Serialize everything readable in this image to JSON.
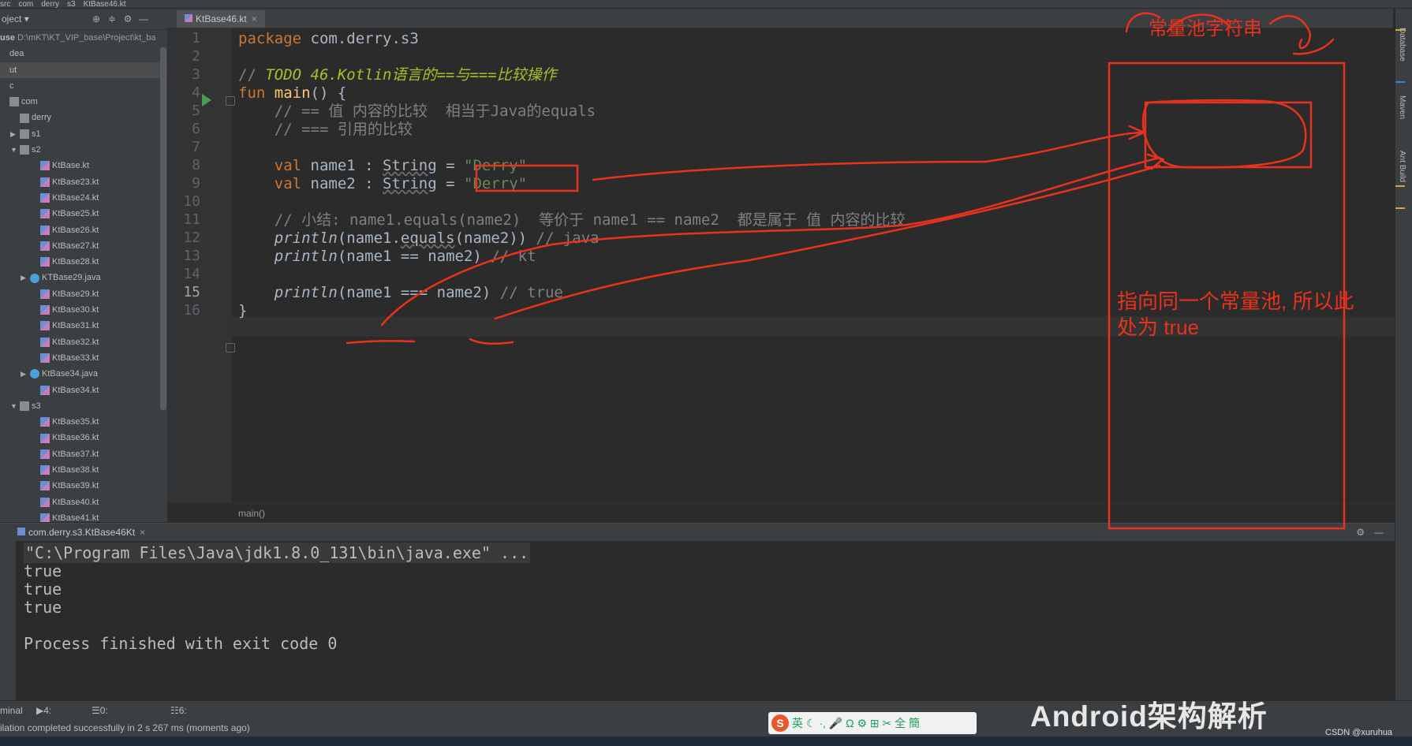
{
  "top_breadcrumb": [
    "src",
    "com",
    "derry",
    "s3",
    "KtBase46.kt"
  ],
  "project_panel": {
    "title": "oject",
    "root_label": "use",
    "root_path": "D:\\mKT\\KT_VIP_base\\Project\\kt_ba",
    "items": [
      {
        "label": "dea",
        "indent": 0,
        "arrow": "",
        "icon": "none"
      },
      {
        "label": "ut",
        "indent": 0,
        "arrow": "",
        "icon": "none",
        "selected": true
      },
      {
        "label": "c",
        "indent": 0,
        "arrow": "",
        "icon": "none"
      },
      {
        "label": "com",
        "indent": 0,
        "arrow": "",
        "icon": "folder"
      },
      {
        "label": "derry",
        "indent": 1,
        "arrow": "",
        "icon": "folder"
      },
      {
        "label": "s1",
        "indent": 1,
        "arrow": "▶",
        "icon": "folder"
      },
      {
        "label": "s2",
        "indent": 1,
        "arrow": "▼",
        "icon": "folder"
      },
      {
        "label": "KtBase.kt",
        "indent": 3,
        "arrow": "",
        "icon": "kt"
      },
      {
        "label": "KtBase23.kt",
        "indent": 3,
        "arrow": "",
        "icon": "kt"
      },
      {
        "label": "KtBase24.kt",
        "indent": 3,
        "arrow": "",
        "icon": "kt"
      },
      {
        "label": "KtBase25.kt",
        "indent": 3,
        "arrow": "",
        "icon": "kt"
      },
      {
        "label": "KtBase26.kt",
        "indent": 3,
        "arrow": "",
        "icon": "kt"
      },
      {
        "label": "KtBase27.kt",
        "indent": 3,
        "arrow": "",
        "icon": "kt"
      },
      {
        "label": "KtBase28.kt",
        "indent": 3,
        "arrow": "",
        "icon": "kt"
      },
      {
        "label": "KTBase29.java",
        "indent": 2,
        "arrow": "▶",
        "icon": "java"
      },
      {
        "label": "KtBase29.kt",
        "indent": 3,
        "arrow": "",
        "icon": "kt"
      },
      {
        "label": "KtBase30.kt",
        "indent": 3,
        "arrow": "",
        "icon": "kt"
      },
      {
        "label": "KtBase31.kt",
        "indent": 3,
        "arrow": "",
        "icon": "kt"
      },
      {
        "label": "KtBase32.kt",
        "indent": 3,
        "arrow": "",
        "icon": "kt"
      },
      {
        "label": "KtBase33.kt",
        "indent": 3,
        "arrow": "",
        "icon": "kt"
      },
      {
        "label": "KtBase34.java",
        "indent": 2,
        "arrow": "▶",
        "icon": "java"
      },
      {
        "label": "KtBase34.kt",
        "indent": 3,
        "arrow": "",
        "icon": "kt"
      },
      {
        "label": "s3",
        "indent": 1,
        "arrow": "▼",
        "icon": "folder"
      },
      {
        "label": "KtBase35.kt",
        "indent": 3,
        "arrow": "",
        "icon": "kt"
      },
      {
        "label": "KtBase36.kt",
        "indent": 3,
        "arrow": "",
        "icon": "kt"
      },
      {
        "label": "KtBase37.kt",
        "indent": 3,
        "arrow": "",
        "icon": "kt"
      },
      {
        "label": "KtBase38.kt",
        "indent": 3,
        "arrow": "",
        "icon": "kt"
      },
      {
        "label": "KtBase39.kt",
        "indent": 3,
        "arrow": "",
        "icon": "kt"
      },
      {
        "label": "KtBase40.kt",
        "indent": 3,
        "arrow": "",
        "icon": "kt"
      },
      {
        "label": "KtBase41.kt",
        "indent": 3,
        "arrow": "",
        "icon": "kt"
      }
    ]
  },
  "editor": {
    "tab_label": "KtBase46.kt",
    "current_line": 15,
    "line_numbers": [
      "1",
      "2",
      "3",
      "4",
      "5",
      "6",
      "7",
      "8",
      "9",
      "10",
      "11",
      "12",
      "13",
      "14",
      "15",
      "16"
    ],
    "breadcrumb": "main()",
    "code_lines": [
      [
        {
          "t": "package ",
          "c": "kw"
        },
        {
          "t": "com.derry.s3",
          "c": "pl"
        }
      ],
      [],
      [
        {
          "t": "// ",
          "c": "cmt"
        },
        {
          "t": "TODO 46.Kotlin语言的==与===比较操作",
          "c": "todo"
        }
      ],
      [
        {
          "t": "fun ",
          "c": "kw"
        },
        {
          "t": "main",
          "c": "fn"
        },
        {
          "t": "() {",
          "c": "pl"
        }
      ],
      [
        {
          "t": "    // == 值 内容的比较  相当于Java的equals",
          "c": "cmt"
        }
      ],
      [
        {
          "t": "    // === 引用的比较",
          "c": "cmt"
        }
      ],
      [],
      [
        {
          "t": "    ",
          "c": "pl"
        },
        {
          "t": "val ",
          "c": "kw"
        },
        {
          "t": "name1 : ",
          "c": "pl"
        },
        {
          "t": "String",
          "c": "pl ul"
        },
        {
          "t": " = ",
          "c": "pl"
        },
        {
          "t": "\"Derry\"",
          "c": "str"
        }
      ],
      [
        {
          "t": "    ",
          "c": "pl"
        },
        {
          "t": "val ",
          "c": "kw"
        },
        {
          "t": "name2 : ",
          "c": "pl"
        },
        {
          "t": "String",
          "c": "pl ul"
        },
        {
          "t": " = ",
          "c": "pl"
        },
        {
          "t": "\"Derry\"",
          "c": "str"
        }
      ],
      [],
      [
        {
          "t": "    // 小结: name1.equals(name2)  等价于 name1 == name2  都是属于 值 内容的比较",
          "c": "cmt"
        }
      ],
      [
        {
          "t": "    ",
          "c": "pl"
        },
        {
          "t": "println",
          "c": "pl it"
        },
        {
          "t": "(name1.",
          "c": "pl"
        },
        {
          "t": "equals",
          "c": "pl ul"
        },
        {
          "t": "(name2)) ",
          "c": "pl"
        },
        {
          "t": "// java",
          "c": "cmt"
        }
      ],
      [
        {
          "t": "    ",
          "c": "pl"
        },
        {
          "t": "println",
          "c": "pl it"
        },
        {
          "t": "(name1 == name2) ",
          "c": "pl"
        },
        {
          "t": "// kt",
          "c": "cmt"
        }
      ],
      [],
      [
        {
          "t": "    ",
          "c": "pl"
        },
        {
          "t": "println",
          "c": "pl it"
        },
        {
          "t": "(name1 === name2) ",
          "c": "pl"
        },
        {
          "t": "// true",
          "c": "cmt"
        }
      ],
      [
        {
          "t": "}",
          "c": "pl"
        }
      ]
    ]
  },
  "run_panel": {
    "tab_label": "com.derry.s3.KtBase46Kt",
    "output_lines": [
      "\"C:\\Program Files\\Java\\jdk1.8.0_131\\bin\\java.exe\" ...",
      "true",
      "true",
      "true",
      "",
      "Process finished with exit code 0"
    ]
  },
  "tool_tabs": [
    "minal",
    "4: Run",
    "0: Messages",
    "6: TODO"
  ],
  "status_text": "ilation completed successfully in 2 s 267 ms (moments ago)",
  "right_strip": [
    "Database",
    "Maven",
    "Ant Build"
  ],
  "annotations": {
    "top": "常量池字符串",
    "middle": "指向同一个常量池, 所以此处为 true",
    "color": "#e8321e"
  },
  "watermark": "Android架构解析",
  "csdn": "CSDN @xuruhua",
  "ime_label": "英"
}
